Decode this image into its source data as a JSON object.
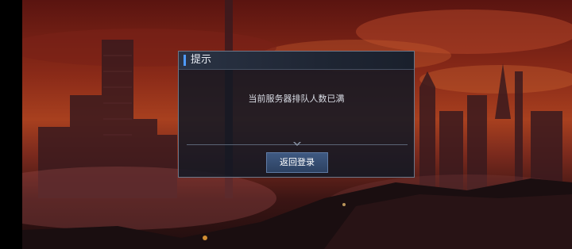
{
  "dialog": {
    "title": "提示",
    "message": "当前服务器排队人数已满",
    "button_label": "返回登录"
  },
  "colors": {
    "accent": "#4f9bff",
    "dialog_bg": "#121824",
    "button_bg": "#2d4262"
  },
  "icons": {
    "divider": "chevron-down-icon"
  }
}
